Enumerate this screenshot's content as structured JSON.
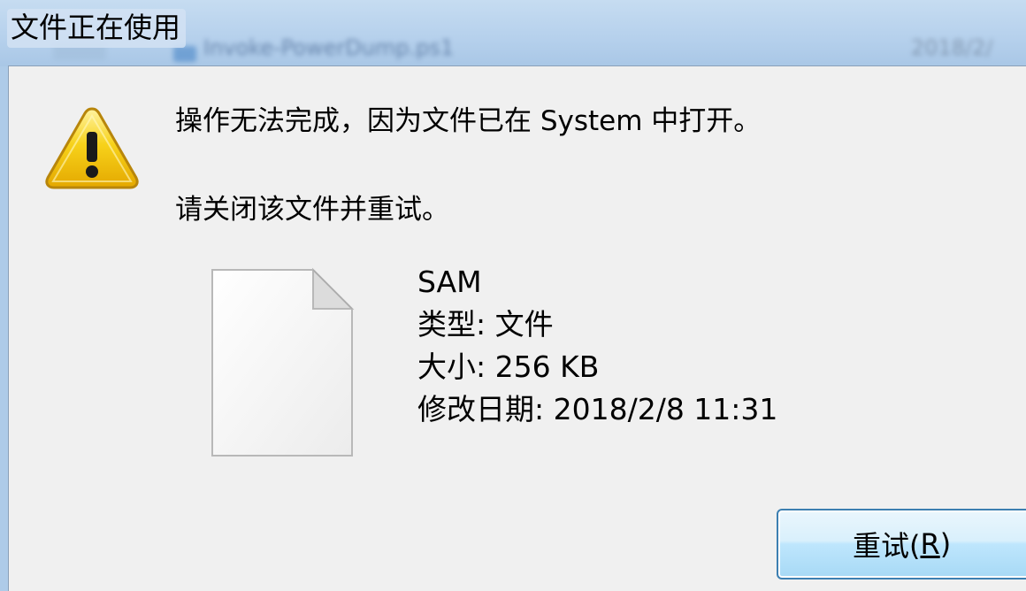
{
  "window": {
    "title": "文件正在使用",
    "background_text": "Invoke-PowerDump.ps1",
    "background_date": "2018/2/"
  },
  "message": {
    "main": "操作无法完成，因为文件已在 System 中打开。",
    "sub": "请关闭该文件并重试。"
  },
  "file": {
    "name": "SAM",
    "type": "类型: 文件",
    "size": "大小: 256 KB",
    "modified": "修改日期: 2018/2/8 11:31"
  },
  "buttons": {
    "retry_prefix": "重试(",
    "retry_key": "R",
    "retry_suffix": ")"
  },
  "icons": {
    "warning": "warning-icon",
    "file": "file-icon"
  },
  "colors": {
    "dialog_bg": "#f0f0f0",
    "button_border": "#3c7fb1",
    "warning_fill": "#f5c400"
  }
}
